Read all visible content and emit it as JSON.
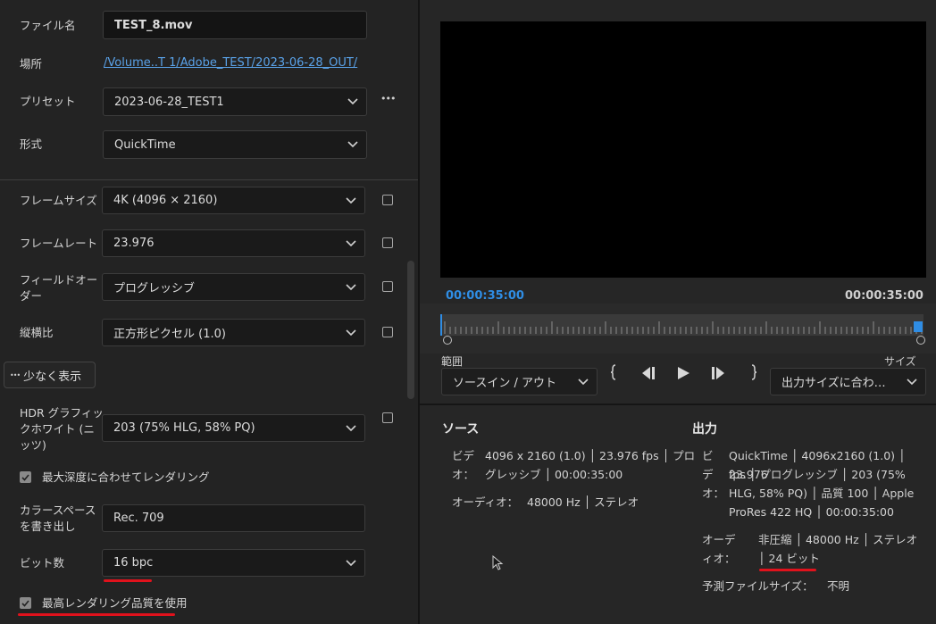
{
  "left": {
    "filename": {
      "label": "ファイル名",
      "value": "TEST_8.mov"
    },
    "location": {
      "label": "場所",
      "value": "/Volume..T 1/Adobe_TEST/2023-06-28_OUT/"
    },
    "preset": {
      "label": "プリセット",
      "value": "2023-06-28_TEST1",
      "more": "•••"
    },
    "format": {
      "label": "形式",
      "value": "QuickTime"
    },
    "frame_size": {
      "label": "フレームサイズ",
      "value": "4K (4096 × 2160)"
    },
    "frame_rate": {
      "label": "フレームレート",
      "value": "23.976"
    },
    "field_order": {
      "label_l1": "フィールドオー",
      "label_l2": "ダー",
      "value": "プログレッシブ"
    },
    "aspect": {
      "label": "縦横比",
      "value": "正方形ピクセル (1.0)"
    },
    "show_less": {
      "dots": "•••",
      "label": "少なく表示"
    },
    "hdr": {
      "label_l1": "HDR グラフィッ",
      "label_l2": "クホワイト (ニ",
      "label_l3": "ッツ)",
      "value": "203 (75% HLG, 58% PQ)"
    },
    "max_depth": {
      "label": "最大深度に合わせてレンダリング",
      "checked": true
    },
    "colorspace": {
      "label_l1": "カラースペース",
      "label_l2": "を書き出し",
      "value": "Rec. 709"
    },
    "bit_depth": {
      "label": "ビット数",
      "value": "16 bpc"
    },
    "max_quality": {
      "label": "最高レンダリング品質を使用",
      "checked": true
    }
  },
  "preview": {
    "time_in": "00:00:35:00",
    "time_out": "00:00:35:00",
    "range_label": "範囲",
    "range_value": "ソースイン / アウト",
    "size_label": "サイズ",
    "size_value": "出力サイズに合わ…"
  },
  "source": {
    "title": "ソース",
    "video_key_l1": "ビデ",
    "video_key_l2": "オ：",
    "video_l1": "4096 x 2160 (1.0) │ 23.976 fps │ プロ",
    "video_l2": "グレッシブ │ 00:00:35:00",
    "audio_key": "オーディオ：",
    "audio": "48000 Hz │ ステレオ"
  },
  "output": {
    "title": "出力",
    "video_key_l1": "ビ",
    "video_key_l2": "デ",
    "video_key_l3": "オ：",
    "video_l1": "QuickTime │ 4096x2160 (1.0) │ 23.976",
    "video_l2": "fps │ プログレッシブ │ 203 (75%",
    "video_l3": "HLG, 58% PQ) │ 品質 100 │ Apple",
    "video_l4": "ProRes 422 HQ │ 00:00:35:00",
    "audio_key_l1": "オーデ",
    "audio_key_l2": "ィオ：",
    "audio_l1": "非圧縮 │ 48000 Hz │ ステレオ",
    "audio_l2": "│ 24 ビット",
    "filesize_key": "予測ファイルサイズ：",
    "filesize": "不明"
  },
  "colors": {
    "accent": "#2f8de4",
    "highlight": "#e0121c"
  }
}
